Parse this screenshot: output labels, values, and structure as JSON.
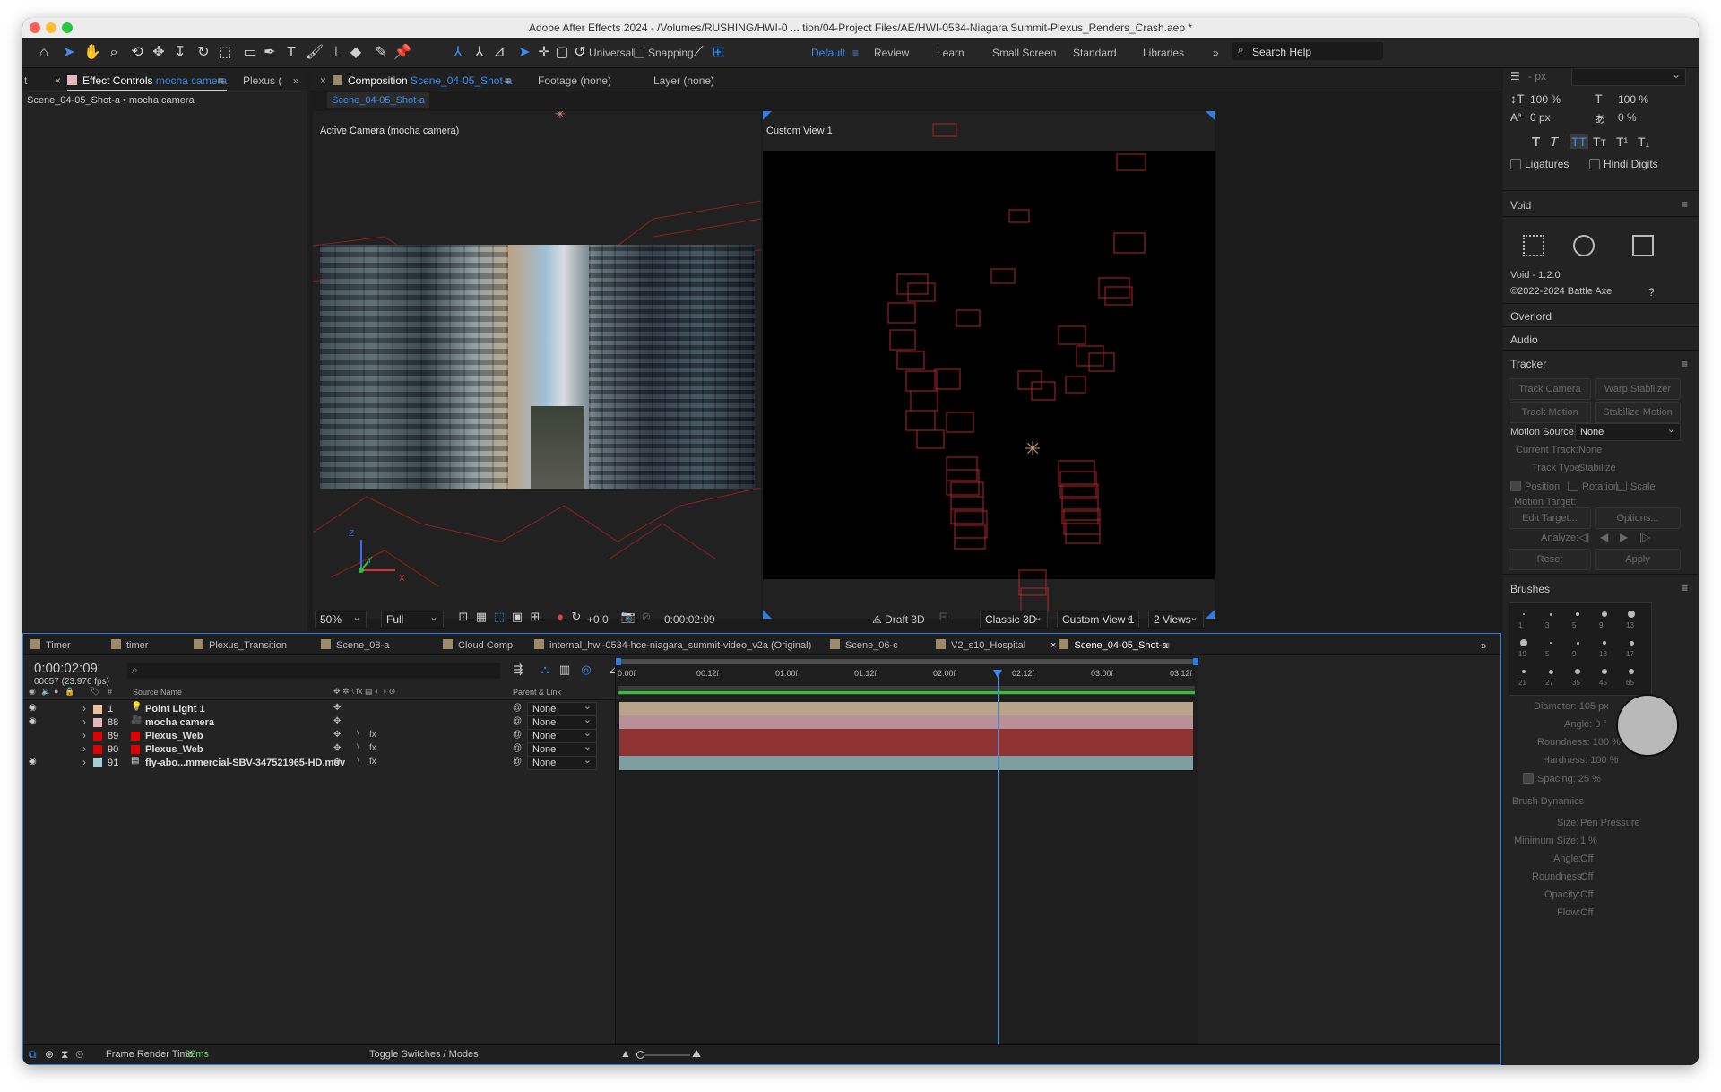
{
  "title": "Adobe After Effects 2024 - /Volumes/RUSHING/HWI-0 ... tion/04-Project Files/AE/HWI-0534-Niagara Summit-Plexus_Renders_Crash.aep *",
  "toolbar": {
    "universal": "Universal",
    "snapping": "Snapping",
    "search": "Search Help",
    "workspaces": [
      "Default",
      "Review",
      "Learn",
      "Small Screen",
      "Standard",
      "Libraries"
    ]
  },
  "left": {
    "tab_prefix": "t",
    "tab_effect": "Effect Controls",
    "tab_effect_target": "mocha camera",
    "tab_plexus": "Plexus (",
    "breadcrumb": "Scene_04-05_Shot-a • mocha camera"
  },
  "viewer": {
    "tab_comp": "Composition",
    "tab_comp_name": "Scene_04-05_Shot-a",
    "tab_footage": "Footage (none)",
    "tab_layer": "Layer (none)",
    "subtab": "Scene_04-05_Shot-a",
    "active_camera": "Active Camera (mocha camera)",
    "custom_view": "Custom View 1",
    "axis_z": "Z",
    "axis_y": "Y",
    "axis_x": "X",
    "zoom": "50%",
    "resolution": "Full",
    "exposure": "+0.0",
    "time": "0:00:02:09",
    "draft3d": "Draft 3D",
    "renderer": "Classic 3D",
    "view": "Custom View 1",
    "views": "2 Views"
  },
  "character": {
    "unit": "- px",
    "vscale": "100 %",
    "hscale": "100 %",
    "baseline": "0 px",
    "tsume": "0 %",
    "ligatures": "Ligatures",
    "hindi": "Hindi Digits",
    "styles": [
      "T",
      "T",
      "TT",
      "Tт",
      "T¹",
      "T₁"
    ]
  },
  "void": {
    "title": "Void",
    "version": "Void - 1.2.0",
    "copyright": "©2022-2024 Battle Axe",
    "help": "?"
  },
  "overlord": "Overlord",
  "audio": "Audio",
  "tracker": {
    "title": "Tracker",
    "track_camera": "Track Camera",
    "warp": "Warp Stabilizer",
    "track_motion": "Track Motion",
    "stab_motion": "Stabilize Motion",
    "motion_source_label": "Motion Source:",
    "motion_source": "None",
    "current_track_label": "Current Track:",
    "current_track": "None",
    "track_type_label": "Track Type:",
    "track_type": "Stabilize",
    "position": "Position",
    "rotation": "Rotation",
    "scale": "Scale",
    "motion_target": "Motion Target:",
    "edit_target": "Edit Target...",
    "options": "Options...",
    "analyze": "Analyze:",
    "reset": "Reset",
    "apply": "Apply"
  },
  "brushes": {
    "title": "Brushes",
    "sizes": [
      [
        "1",
        "3",
        "5",
        "9",
        "13"
      ],
      [
        "19",
        "5",
        "9",
        "13",
        "17"
      ],
      [
        "21",
        "27",
        "35",
        "45",
        "65"
      ]
    ],
    "diameter": "Diameter: 105 px",
    "angle": "Angle: 0 °",
    "roundness": "Roundness: 100 %",
    "hardness": "Hardness: 100 %",
    "spacing": "Spacing:  25 %",
    "dynamics": "Brush Dynamics",
    "size_label": "Size:",
    "size": "Pen Pressure",
    "min_size_label": "Minimum Size:",
    "min_size": "1 %",
    "angle_label": "Angle:",
    "angle_val": "Off",
    "round_label": "Roundness:",
    "round_val": "Off",
    "opacity_label": "Opacity:",
    "opacity_val": "Off",
    "flow_label": "Flow:",
    "flow_val": "Off"
  },
  "timeline": {
    "tabs": [
      "Timer",
      "timer",
      "Plexus_Transition",
      "Scene_08-a",
      "Cloud Comp",
      "internal_hwi-0534-hce-niagara_summit-video_v2a (Original)",
      "Scene_06-c",
      "V2_s10_Hospital",
      "Scene_04-05_Shot-a"
    ],
    "timecode": "0:00:02:09",
    "fps": "00057 (23.976 fps)",
    "col_hash": "#",
    "col_source": "Source Name",
    "col_parent": "Parent & Link",
    "ruler": [
      "0:00f",
      "00:12f",
      "01:00f",
      "01:12f",
      "02:00f",
      "02:12f",
      "03:00f",
      "03:12f"
    ],
    "layers": [
      {
        "num": "1",
        "name": "Point Light 1",
        "parent": "None",
        "color": "#e8c09a",
        "icon": "light-bulb-icon",
        "fx": false
      },
      {
        "num": "88",
        "name": "mocha camera",
        "parent": "None",
        "color": "#e7b5bb",
        "icon": "camera-icon",
        "fx": false
      },
      {
        "num": "89",
        "name": "Plexus_Web",
        "parent": "None",
        "color": "#e00000",
        "icon": "",
        "fx": true
      },
      {
        "num": "90",
        "name": "Plexus_Web",
        "parent": "None",
        "color": "#e00000",
        "icon": "",
        "fx": true
      },
      {
        "num": "91",
        "name": "fly-abo...mmercial-SBV-347521965-HD.mov",
        "parent": "None",
        "color": "#a0d0d0",
        "icon": "footage-icon",
        "fx": true
      }
    ],
    "render_label": "Frame Render Time",
    "render_time": "22ms",
    "toggle": "Toggle Switches / Modes"
  }
}
